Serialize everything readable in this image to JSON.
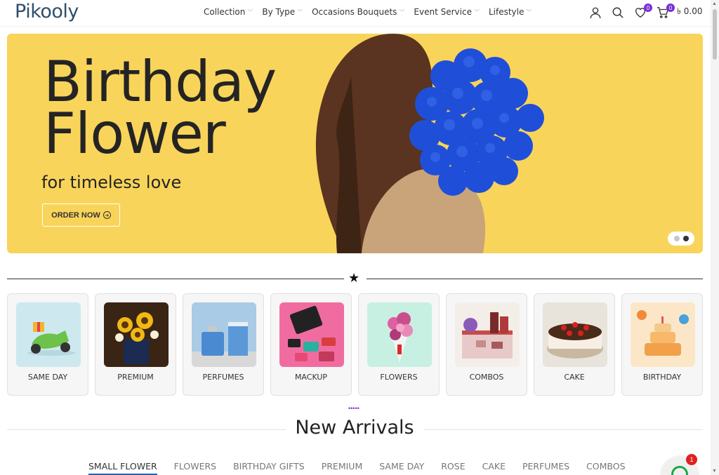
{
  "header": {
    "logo": "Pikooly",
    "nav": [
      {
        "label": "Collection"
      },
      {
        "label": "By Type"
      },
      {
        "label": "Occasions Bouquets"
      },
      {
        "label": "Event Service"
      },
      {
        "label": "Lifestyle"
      }
    ],
    "wishlist_count": "0",
    "cart_count": "0",
    "cart_total": "৳ 0.00"
  },
  "hero": {
    "title_line1": "Birthday",
    "title_line2": "Flower",
    "subtitle": "for timeless love",
    "cta": "ORDER NOW",
    "bg_color": "#f9d45a",
    "slides": 2,
    "active_slide": 2
  },
  "categories": [
    {
      "label": "SAME DAY",
      "icon": "scooter-gift-image"
    },
    {
      "label": "PREMIUM",
      "icon": "sunflower-box-image"
    },
    {
      "label": "PERFUMES",
      "icon": "perfume-bottle-image"
    },
    {
      "label": "MACKUP",
      "icon": "makeup-kit-image"
    },
    {
      "label": "FLOWERS",
      "icon": "bouquet-image"
    },
    {
      "label": "COMBOS",
      "icon": "gift-combo-image"
    },
    {
      "label": "CAKE",
      "icon": "cake-image"
    },
    {
      "label": "BIRTHDAY",
      "icon": "birthday-cake-image"
    }
  ],
  "new_arrivals": {
    "title": "New Arrivals",
    "tabs": [
      {
        "label": "SMALL FLOWER",
        "active": true
      },
      {
        "label": "FLOWERS"
      },
      {
        "label": "BIRTHDAY GIFTS"
      },
      {
        "label": "PREMIUM"
      },
      {
        "label": "SAME DAY"
      },
      {
        "label": "ROSE"
      },
      {
        "label": "CAKE"
      },
      {
        "label": "PERFUMES"
      },
      {
        "label": "COMBOS"
      }
    ]
  },
  "chat": {
    "badge": "1"
  },
  "colors": {
    "accent": "#7a2fd6",
    "tab_underline": "#2e5fa8",
    "chat_green": "#1fa64a"
  }
}
